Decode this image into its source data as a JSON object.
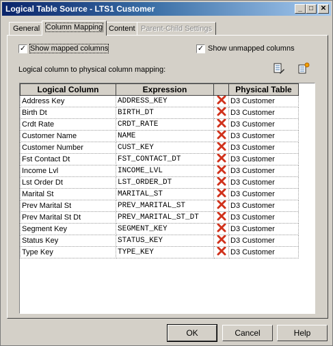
{
  "window": {
    "title": "Logical Table Source - LTS1 Customer"
  },
  "tabs": [
    {
      "label": "General",
      "state": "normal"
    },
    {
      "label": "Column Mapping",
      "state": "active"
    },
    {
      "label": "Content",
      "state": "normal"
    },
    {
      "label": "Parent-Child Settings",
      "state": "disabled"
    }
  ],
  "options": {
    "show_mapped_label": "Show mapped columns",
    "show_mapped_checked": true,
    "show_unmapped_label": "Show unmapped columns",
    "show_unmapped_checked": true
  },
  "mapping": {
    "section_label": "Logical column to physical column mapping:",
    "headers": {
      "logical": "Logical Column",
      "expression": "Expression",
      "physical": "Physical Table"
    },
    "rows": [
      {
        "logical": "Address Key",
        "expression": "ADDRESS_KEY",
        "physical": "D3 Customer"
      },
      {
        "logical": "Birth Dt",
        "expression": "BIRTH_DT",
        "physical": "D3 Customer"
      },
      {
        "logical": "Crdt Rate",
        "expression": "CRDT_RATE",
        "physical": "D3 Customer"
      },
      {
        "logical": "Customer Name",
        "expression": "NAME",
        "physical": "D3 Customer"
      },
      {
        "logical": "Customer Number",
        "expression": "CUST_KEY",
        "physical": "D3 Customer"
      },
      {
        "logical": "Fst Contact Dt",
        "expression": "FST_CONTACT_DT",
        "physical": "D3 Customer"
      },
      {
        "logical": "Income Lvl",
        "expression": "INCOME_LVL",
        "physical": "D3 Customer"
      },
      {
        "logical": "Lst Order Dt",
        "expression": "LST_ORDER_DT",
        "physical": "D3 Customer"
      },
      {
        "logical": "Marital St",
        "expression": "MARITAL_ST",
        "physical": "D3 Customer"
      },
      {
        "logical": "Prev Marital St",
        "expression": "PREV_MARITAL_ST",
        "physical": "D3 Customer"
      },
      {
        "logical": "Prev Marital St Dt",
        "expression": "PREV_MARITAL_ST_DT",
        "physical": "D3 Customer"
      },
      {
        "logical": "Segment Key",
        "expression": "SEGMENT_KEY",
        "physical": "D3 Customer"
      },
      {
        "logical": "Status Key",
        "expression": "STATUS_KEY",
        "physical": "D3 Customer"
      },
      {
        "logical": "Type Key",
        "expression": "TYPE_KEY",
        "physical": "D3 Customer"
      }
    ]
  },
  "buttons": {
    "ok": "OK",
    "cancel": "Cancel",
    "help": "Help"
  },
  "colors": {
    "title_start": "#0a246a",
    "title_end": "#a6caf0",
    "face": "#d4d0c8",
    "delete_icon": "#d0311b"
  }
}
